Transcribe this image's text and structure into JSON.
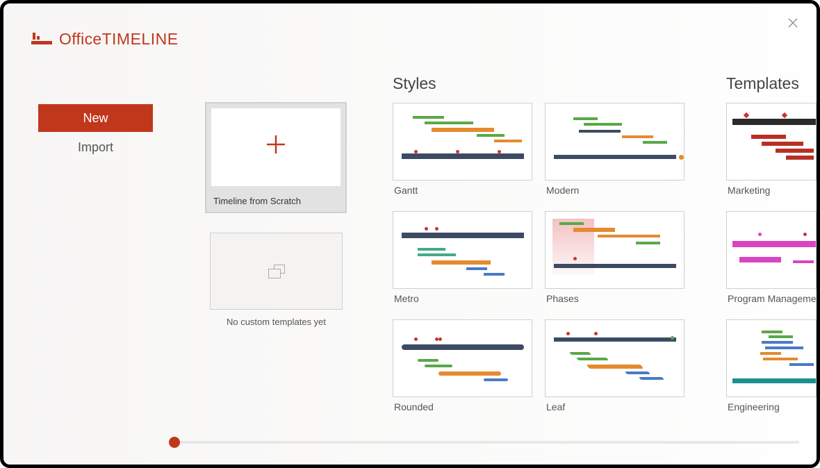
{
  "app": {
    "brand_prefix": "Office",
    "brand_suffix": "TIMELINE"
  },
  "nav": {
    "new_label": "New",
    "import_label": "Import"
  },
  "scratch": {
    "label": "Timeline from Scratch"
  },
  "custom": {
    "label": "No custom templates yet"
  },
  "sections": {
    "styles_title": "Styles",
    "templates_title": "Templates"
  },
  "styles": [
    {
      "label": "Gantt"
    },
    {
      "label": "Modern"
    },
    {
      "label": "Metro"
    },
    {
      "label": "Phases"
    },
    {
      "label": "Rounded"
    },
    {
      "label": "Leaf"
    }
  ],
  "templates": [
    {
      "label": "Marketing"
    },
    {
      "label": "Program Management"
    },
    {
      "label": "Engineering"
    }
  ],
  "colors": {
    "accent": "#c1371c"
  }
}
